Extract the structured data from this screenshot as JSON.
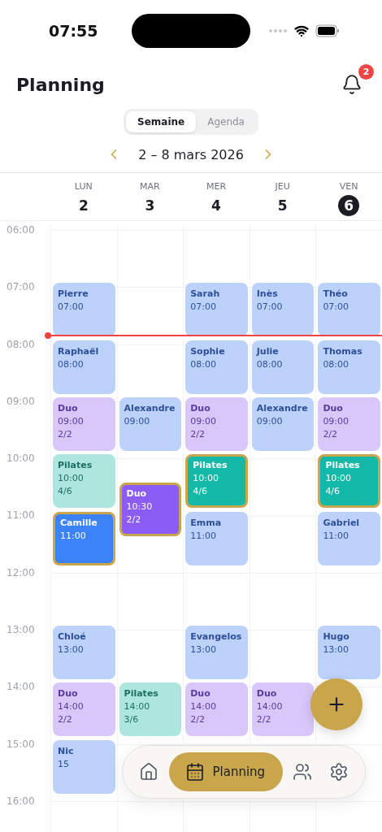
{
  "status_bar": {
    "time": "07:55"
  },
  "header": {
    "title": "Planning",
    "notification_count": "2"
  },
  "view_tabs": [
    {
      "label": "Semaine",
      "selected": true
    },
    {
      "label": "Agenda",
      "selected": false
    }
  ],
  "week": {
    "range": "2 – 8 mars 2026"
  },
  "days": [
    {
      "weekday": "LUN",
      "date": "2",
      "today": false
    },
    {
      "weekday": "MAR",
      "date": "3",
      "today": false
    },
    {
      "weekday": "MER",
      "date": "4",
      "today": false
    },
    {
      "weekday": "JEU",
      "date": "5",
      "today": false
    },
    {
      "weekday": "VEN",
      "date": "6",
      "today": true
    }
  ],
  "hours": [
    {
      "label": "06:00",
      "cells": [
        null,
        null,
        null,
        null,
        null
      ]
    },
    {
      "label": "07:00",
      "cells": [
        {
          "kind": "private",
          "name": "Pierre",
          "time": "07:00",
          "highlighted": false
        },
        null,
        {
          "kind": "private",
          "name": "Sarah",
          "time": "07:00",
          "highlighted": false
        },
        {
          "kind": "private",
          "name": "Inès",
          "time": "07:00",
          "highlighted": false
        },
        {
          "kind": "private",
          "name": "Théo",
          "time": "07:00",
          "highlighted": false
        }
      ]
    },
    {
      "label": "08:00",
      "cells": [
        {
          "kind": "private",
          "name": "Raphaël",
          "time": "08:00",
          "highlighted": false
        },
        null,
        {
          "kind": "private",
          "name": "Sophie",
          "time": "08:00",
          "highlighted": false
        },
        {
          "kind": "private",
          "name": "Julie",
          "time": "08:00",
          "highlighted": false
        },
        {
          "kind": "private",
          "name": "Thomas",
          "time": "08:00",
          "highlighted": false
        }
      ]
    },
    {
      "label": "09:00",
      "cells": [
        {
          "kind": "duo",
          "name": "Duo",
          "time": "09:00",
          "capacity": "2/2",
          "highlighted": false
        },
        {
          "kind": "private",
          "name": "Alexandre",
          "time": "09:00",
          "highlighted": false
        },
        {
          "kind": "duo",
          "name": "Duo",
          "time": "09:00",
          "capacity": "2/2",
          "highlighted": false
        },
        {
          "kind": "private",
          "name": "Alexandre",
          "time": "09:00",
          "highlighted": false
        },
        {
          "kind": "duo",
          "name": "Duo",
          "time": "09:00",
          "capacity": "2/2",
          "highlighted": false
        }
      ]
    },
    {
      "label": "10:00",
      "cells": [
        {
          "kind": "pilates",
          "name": "Pilates",
          "time": "10:00",
          "capacity": "4/6",
          "highlighted": false
        },
        {
          "kind": "duo",
          "name": "Duo",
          "time": "10:30",
          "capacity": "2/2",
          "highlighted": true,
          "half_hour": true
        },
        {
          "kind": "pilates",
          "name": "Pilates",
          "time": "10:00",
          "capacity": "4/6",
          "highlighted": true
        },
        null,
        {
          "kind": "pilates",
          "name": "Pilates",
          "time": "10:00",
          "capacity": "4/6",
          "highlighted": true
        }
      ]
    },
    {
      "label": "11:00",
      "cells": [
        {
          "kind": "private",
          "name": "Camille",
          "time": "11:00",
          "highlighted": true
        },
        null,
        {
          "kind": "private",
          "name": "Emma",
          "time": "11:00",
          "highlighted": false
        },
        null,
        {
          "kind": "private",
          "name": "Gabriel",
          "time": "11:00",
          "highlighted": false
        }
      ]
    },
    {
      "label": "12:00",
      "cells": [
        null,
        null,
        null,
        null,
        null
      ]
    },
    {
      "label": "13:00",
      "cells": [
        {
          "kind": "private",
          "name": "Chloé",
          "time": "13:00",
          "highlighted": false
        },
        null,
        {
          "kind": "private",
          "name": "Evangelos",
          "time": "13:00",
          "highlighted": false
        },
        null,
        {
          "kind": "private",
          "name": "Hugo",
          "time": "13:00",
          "highlighted": false
        }
      ]
    },
    {
      "label": "14:00",
      "cells": [
        {
          "kind": "duo",
          "name": "Duo",
          "time": "14:00",
          "capacity": "2/2",
          "highlighted": false
        },
        {
          "kind": "pilates",
          "name": "Pilates",
          "time": "14:00",
          "capacity": "3/6",
          "highlighted": false
        },
        {
          "kind": "duo",
          "name": "Duo",
          "time": "14:00",
          "capacity": "2/2",
          "highlighted": false
        },
        {
          "kind": "duo",
          "name": "Duo",
          "time": "14:00",
          "capacity": "2/2",
          "highlighted": false
        },
        null
      ]
    },
    {
      "label": "15:00",
      "cells": [
        {
          "kind": "private",
          "name": "Nic",
          "time": "15",
          "highlighted": false
        },
        null,
        null,
        null,
        null
      ]
    },
    {
      "label": "16:00",
      "cells": [
        null,
        null,
        null,
        null,
        null
      ]
    }
  ],
  "nav": [
    {
      "kind": "home",
      "selected": false
    },
    {
      "kind": "planning",
      "label": "Planning",
      "selected": true
    },
    {
      "kind": "clients",
      "selected": false
    },
    {
      "kind": "settings",
      "selected": false
    }
  ]
}
